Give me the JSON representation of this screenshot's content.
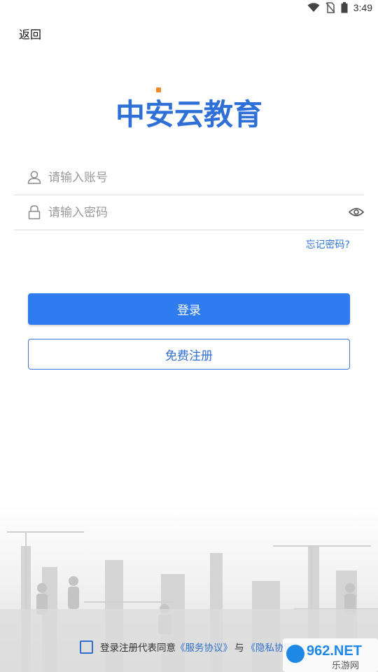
{
  "status": {
    "time": "3:49"
  },
  "nav": {
    "back_label": "返回"
  },
  "logo": {
    "text": "中安云教育",
    "color": "#2f6fd8"
  },
  "form": {
    "account_placeholder": "请输入账号",
    "password_placeholder": "请输入密码",
    "forgot_label": "忘记密码?"
  },
  "buttons": {
    "login_label": "登录",
    "register_label": "免费注册"
  },
  "agreement": {
    "prefix": "登录注册代表同意",
    "service_link": "《服务协议》",
    "conjunction": "与",
    "privacy_link": "《隐私协议》"
  },
  "watermark": {
    "brand": "962.NET",
    "sub": "乐游网"
  },
  "colors": {
    "primary": "#2f7cf0",
    "link": "#2f6fd0"
  }
}
